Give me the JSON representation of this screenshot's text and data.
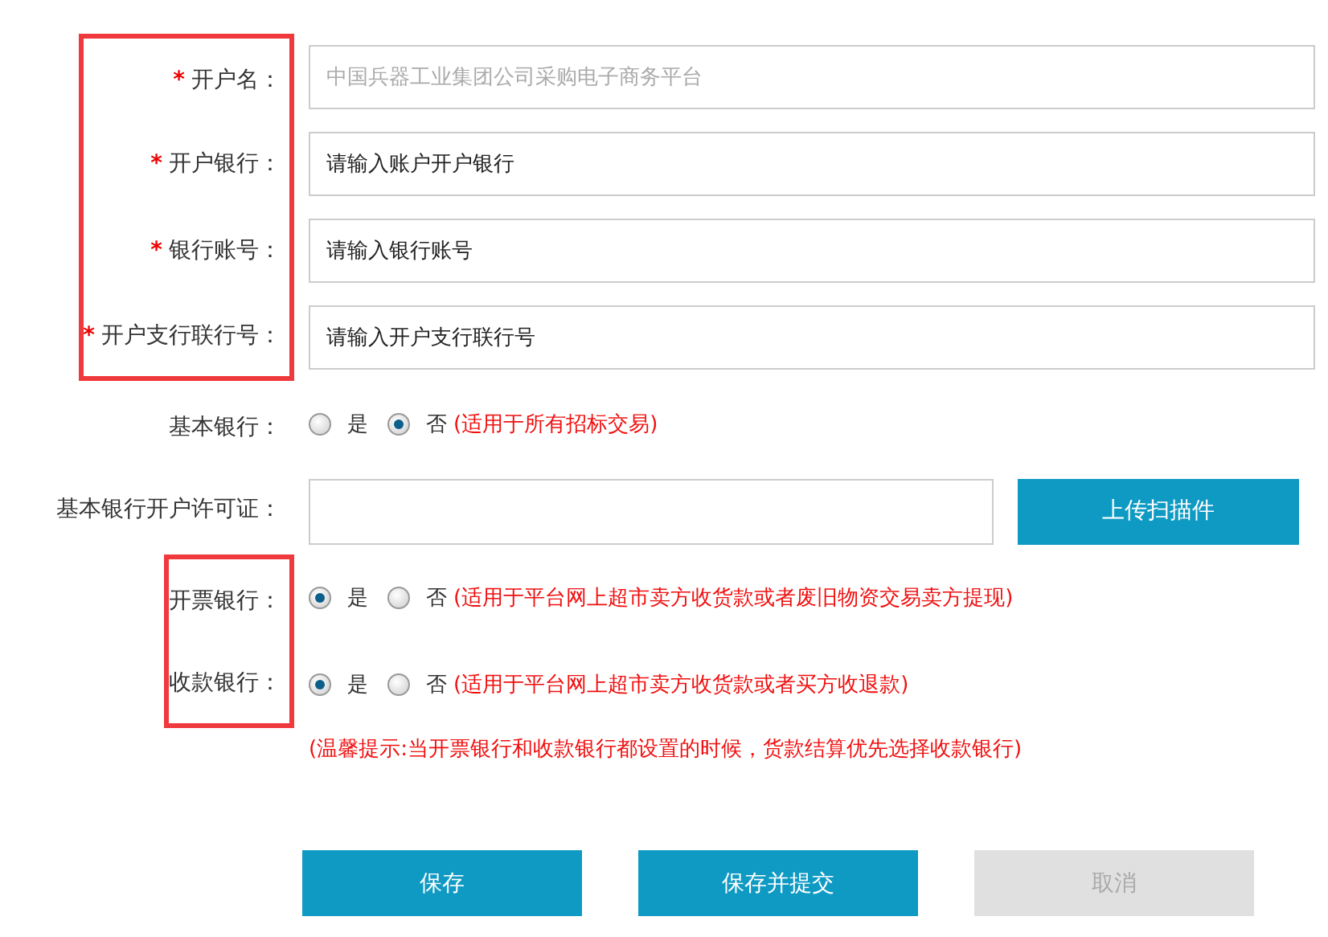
{
  "sections": [
    {
      "highlighted": true,
      "rows": [
        {
          "kind": "input",
          "mark": "*",
          "label": "开户名：",
          "value": "中国兵器工业集团公司采购电子商务平台",
          "disabled": true
        },
        {
          "kind": "input",
          "mark": "*",
          "label": "开户银行：",
          "placeholder": "请输入账户开户银行"
        },
        {
          "kind": "input",
          "mark": "*",
          "label": "银行账号：",
          "placeholder": "请输入银行账号"
        },
        {
          "kind": "input",
          "mark": "*",
          "label": "开户支行联行号：",
          "placeholder": "请输入开户支行联行号"
        }
      ]
    },
    {
      "highlighted": false,
      "rows": [
        {
          "kind": "radio",
          "label": "基本银行：",
          "options": [
            {
              "label": "是",
              "selected": false
            },
            {
              "label": "否",
              "selected": true
            }
          ],
          "note": "(适用于所有招标交易)"
        },
        {
          "kind": "upload",
          "label": "基本银行开户许可证：",
          "button": "上传扫描件"
        }
      ]
    },
    {
      "highlighted": true,
      "rows": [
        {
          "kind": "radio",
          "label": "开票银行：",
          "options": [
            {
              "label": "是",
              "selected": true
            },
            {
              "label": "否",
              "selected": false
            }
          ],
          "note": "(适用于平台网上超市卖方收货款或者废旧物资交易卖方提现)"
        },
        {
          "kind": "radio",
          "label": "收款银行：",
          "options": [
            {
              "label": "是",
              "selected": true
            },
            {
              "label": "否",
              "selected": false
            }
          ],
          "note": "(适用于平台网上超市卖方收货款或者买方收退款)"
        }
      ]
    }
  ],
  "hint": "(温馨提示:当开票银行和收款银行都设置的时候，货款结算优先选择收款银行)",
  "buttons": [
    {
      "label": "保存",
      "disabled": false
    },
    {
      "label": "保存并提交",
      "disabled": false
    },
    {
      "label": "取消",
      "disabled": true
    }
  ]
}
